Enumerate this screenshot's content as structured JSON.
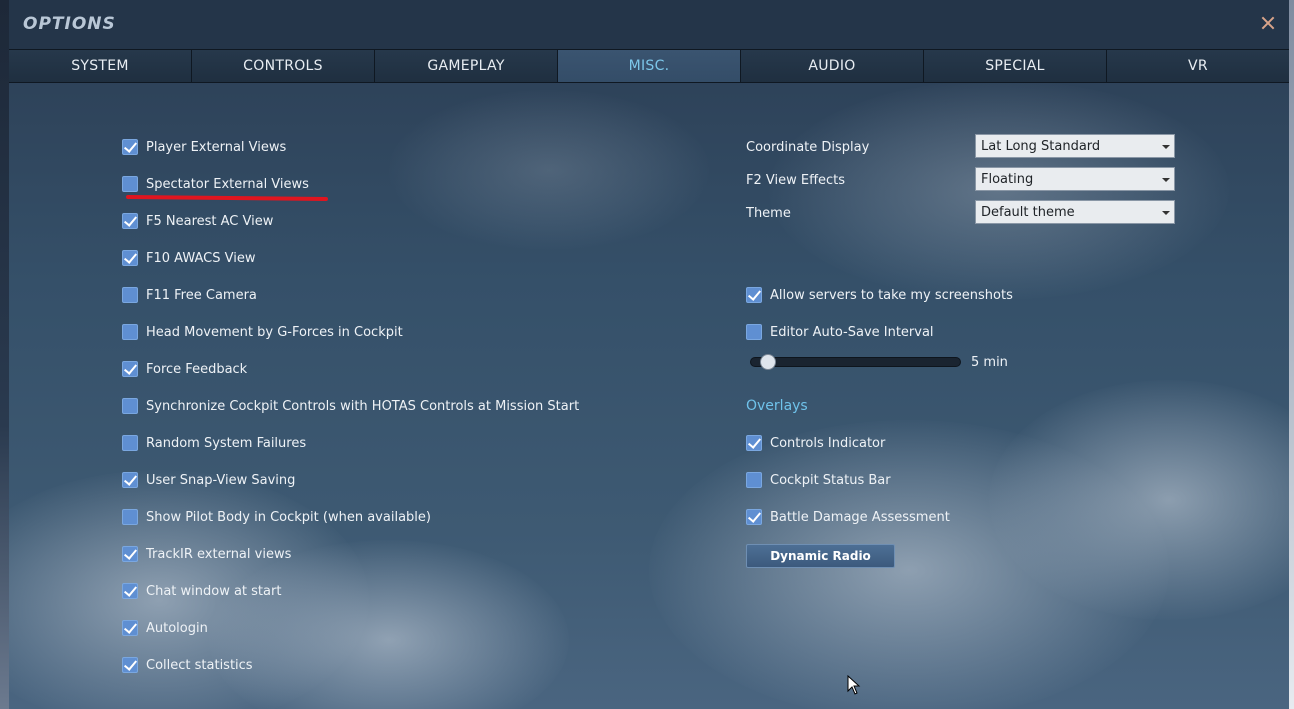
{
  "window": {
    "title": "OPTIONS",
    "close_icon": "close-icon"
  },
  "tabs": [
    {
      "label": "SYSTEM",
      "active": false
    },
    {
      "label": "CONTROLS",
      "active": false
    },
    {
      "label": "GAMEPLAY",
      "active": false
    },
    {
      "label": "MISC.",
      "active": true
    },
    {
      "label": "AUDIO",
      "active": false
    },
    {
      "label": "SPECIAL",
      "active": false
    },
    {
      "label": "VR",
      "active": false
    }
  ],
  "left_options": [
    {
      "label": "Player External Views",
      "checked": true
    },
    {
      "label": "Spectator External Views",
      "checked": false
    },
    {
      "label": "F5 Nearest AC View",
      "checked": true
    },
    {
      "label": "F10 AWACS View",
      "checked": true
    },
    {
      "label": "F11 Free Camera",
      "checked": false
    },
    {
      "label": "Head Movement by G-Forces in Cockpit",
      "checked": false
    },
    {
      "label": "Force Feedback",
      "checked": true
    },
    {
      "label": "Synchronize Cockpit Controls with HOTAS Controls at Mission Start",
      "checked": false
    },
    {
      "label": "Random System Failures",
      "checked": false
    },
    {
      "label": "User Snap-View Saving",
      "checked": true
    },
    {
      "label": "Show Pilot Body in Cockpit (when available)",
      "checked": false
    },
    {
      "label": "TrackIR external views",
      "checked": true
    },
    {
      "label": "Chat window at start",
      "checked": true
    },
    {
      "label": "Autologin",
      "checked": true
    },
    {
      "label": "Collect statistics",
      "checked": true
    }
  ],
  "dropdowns": [
    {
      "label": "Coordinate Display",
      "value": "Lat Long Standard"
    },
    {
      "label": "F2 View Effects",
      "value": "Floating"
    },
    {
      "label": "Theme",
      "value": "Default theme"
    }
  ],
  "right_options": {
    "allow_screenshots": {
      "label": "Allow servers to take my screenshots",
      "checked": true
    },
    "autosave": {
      "label": "Editor Auto-Save Interval",
      "checked": false
    }
  },
  "autosave_slider": {
    "value_label": "5 min",
    "fraction": 0.05
  },
  "overlays": {
    "heading": "Overlays",
    "items": [
      {
        "label": "Controls Indicator",
        "checked": true
      },
      {
        "label": "Cockpit Status Bar",
        "checked": false
      },
      {
        "label": "Battle Damage Assessment",
        "checked": true
      }
    ],
    "dynamic_radio_label": "Dynamic Radio"
  },
  "annotation": {
    "color": "#e0151f"
  },
  "colors": {
    "accent": "#7cc7ea",
    "checkbox": "#5f8fd2"
  }
}
